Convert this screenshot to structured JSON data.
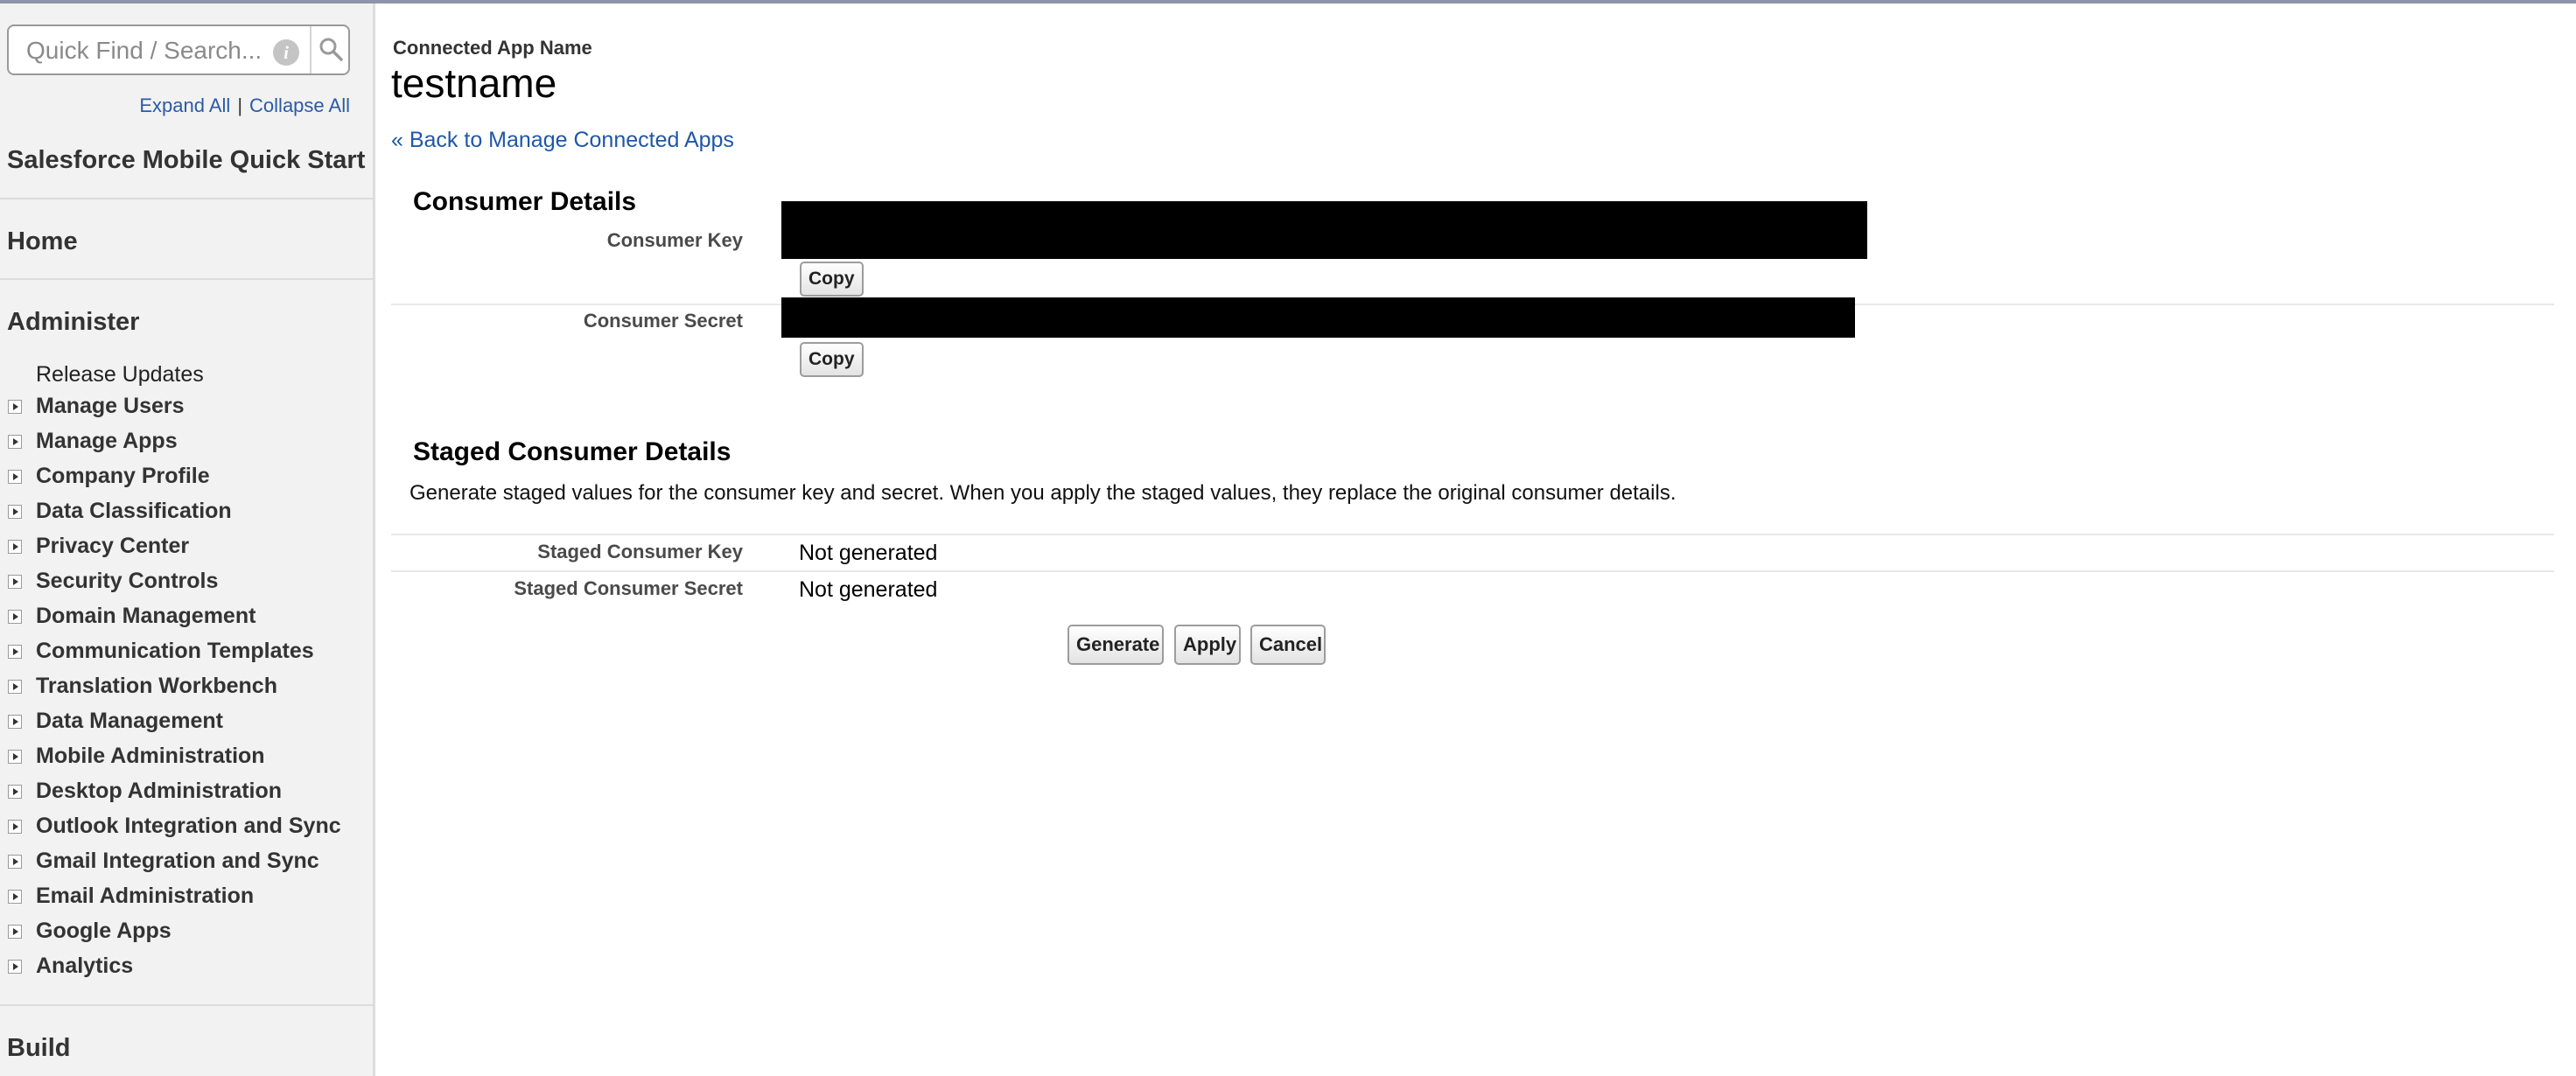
{
  "sidebar": {
    "search": {
      "placeholder": "Quick Find / Search..."
    },
    "expand_all": "Expand All",
    "separator": "|",
    "collapse_all": "Collapse All",
    "mobile_quick_start": "Salesforce Mobile Quick Start",
    "home": "Home",
    "administer": "Administer",
    "release_updates": "Release Updates",
    "admin_items": [
      "Manage Users",
      "Manage Apps",
      "Company Profile",
      "Data Classification",
      "Privacy Center",
      "Security Controls",
      "Domain Management",
      "Communication Templates",
      "Translation Workbench",
      "Data Management",
      "Mobile Administration",
      "Desktop Administration",
      "Outlook Integration and Sync",
      "Gmail Integration and Sync",
      "Email Administration",
      "Google Apps",
      "Analytics"
    ],
    "build": "Build"
  },
  "main": {
    "app_name_label": "Connected App Name",
    "app_name": "testname",
    "back_link": "« Back to Manage Connected Apps",
    "consumer_details": {
      "title": "Consumer Details",
      "key_label": "Consumer Key",
      "secret_label": "Consumer Secret",
      "copy_label": "Copy"
    },
    "staged": {
      "title": "Staged Consumer Details",
      "description": "Generate staged values for the consumer key and secret. When you apply the staged values, they replace the original consumer details.",
      "key_label": "Staged Consumer Key",
      "key_value": "Not generated",
      "secret_label": "Staged Consumer Secret",
      "secret_value": "Not generated"
    },
    "buttons": {
      "generate": "Generate",
      "apply": "Apply",
      "cancel": "Cancel"
    }
  },
  "colors": {
    "link": "#1f57a8",
    "sidebar_bg": "#f2f2f2",
    "redaction": "#000000"
  }
}
